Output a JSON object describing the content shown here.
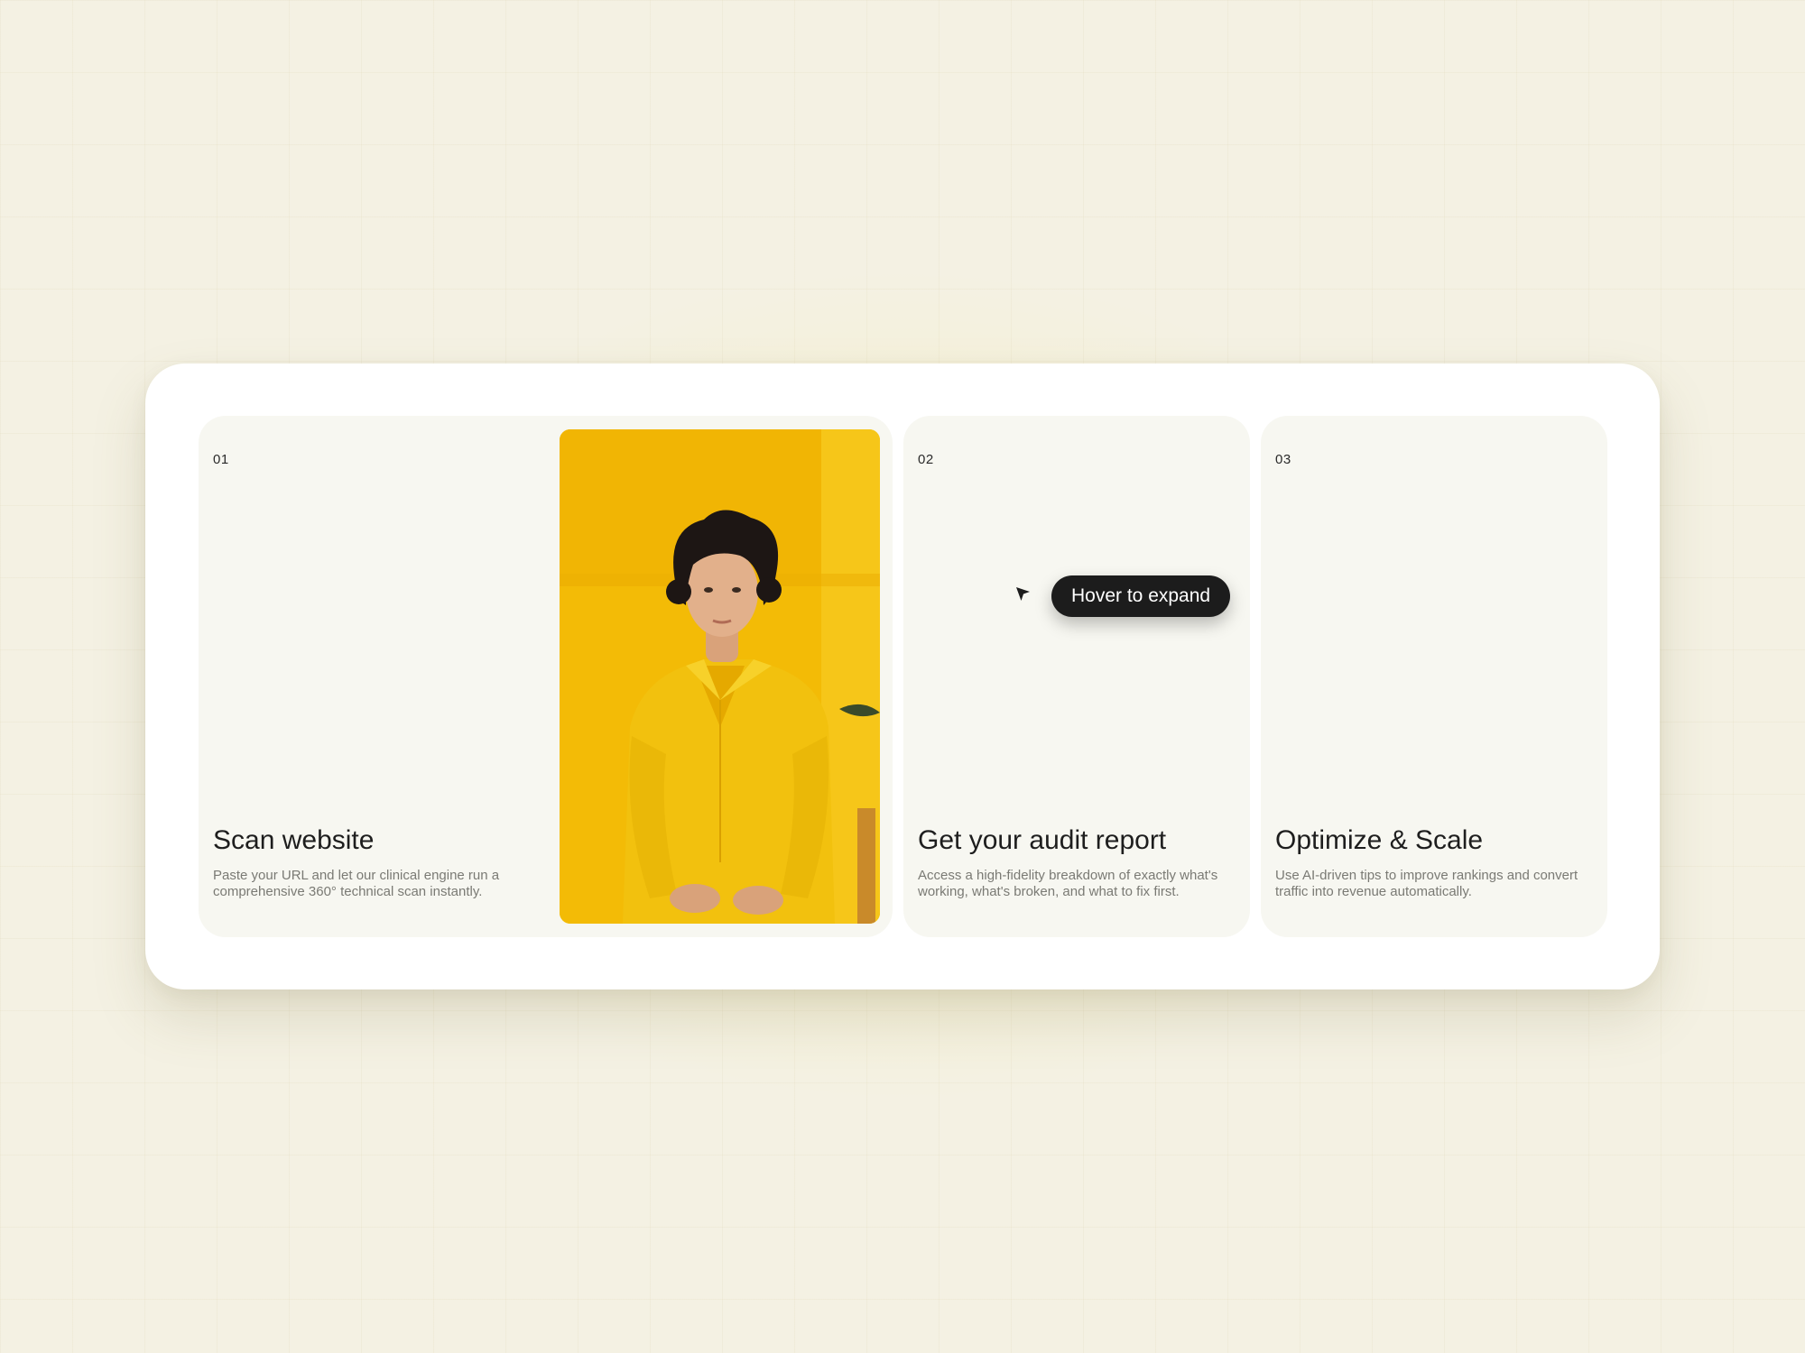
{
  "steps": [
    {
      "number": "01",
      "title": "Scan website",
      "description": "Paste your URL and let our clinical engine run a comprehensive 360° technical scan instantly."
    },
    {
      "number": "02",
      "title": "Get your audit report",
      "description": "Access a high-fidelity breakdown of exactly what's working, what's broken, and what to fix first."
    },
    {
      "number": "03",
      "title": "Optimize & Scale",
      "description": "Use AI-driven tips to improve rankings and convert traffic into revenue automatically."
    }
  ],
  "tooltip": {
    "label": "Hover to expand"
  },
  "photo": {
    "icon": "portrait-photo",
    "accent_color": "#f5c000"
  },
  "colors": {
    "background": "#f4f1e3",
    "panel": "#ffffff",
    "card": "#f7f7f1",
    "tooltip": "#1c1c1c"
  }
}
